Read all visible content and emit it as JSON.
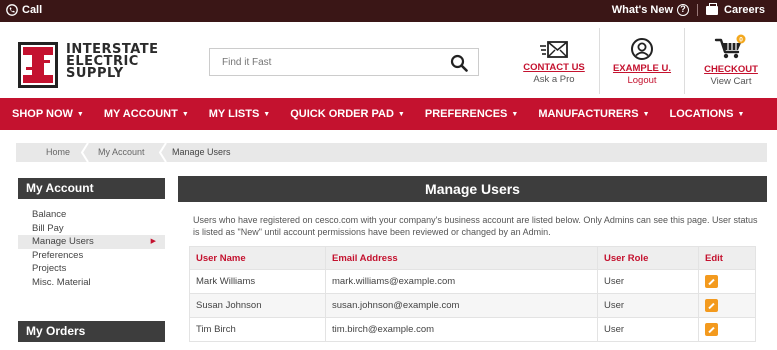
{
  "topbar": {
    "call_label": "Call",
    "whats_new_label": "What's New",
    "careers_label": "Careers"
  },
  "brand": {
    "line1": "INTERSTATE",
    "line2": "ELECTRIC",
    "line3": "SUPPLY"
  },
  "search": {
    "placeholder": "Find it Fast"
  },
  "header": {
    "contact_title": "CONTACT US",
    "contact_sub": "Ask a Pro",
    "user_title": "EXAMPLE U.",
    "user_sub": "Logout",
    "checkout_title": "CHECKOUT",
    "checkout_sub": "View Cart",
    "cart_count": "0"
  },
  "nav": {
    "items": [
      "SHOP NOW",
      "MY ACCOUNT",
      "MY LISTS",
      "QUICK ORDER PAD",
      "PREFERENCES",
      "MANUFACTURERS",
      "LOCATIONS"
    ]
  },
  "breadcrumb": {
    "items": [
      "Home",
      "My Account",
      "Manage Users"
    ]
  },
  "sidebar": {
    "account_heading": "My Account",
    "items": [
      "Balance",
      "Bill Pay",
      "Manage Users",
      "Preferences",
      "Projects",
      "Misc. Material"
    ],
    "orders_heading": "My Orders"
  },
  "main": {
    "title": "Manage Users",
    "description": "Users who have registered on cesco.com with your company's business account are listed below. Only Admins can see this page. User status is listed as \"New\" until account permissions have been reviewed or changed by an Admin.",
    "columns": [
      "User Name",
      "Email Address",
      "User Role",
      "Edit"
    ],
    "rows": [
      {
        "name": "Mark Williams",
        "email": "mark.williams@example.com",
        "role": "User"
      },
      {
        "name": "Susan Johnson",
        "email": "susan.johnson@example.com",
        "role": "User"
      },
      {
        "name": "Tim Birch",
        "email": "tim.birch@example.com",
        "role": "User"
      }
    ]
  },
  "colors": {
    "brand_red": "#c4122f",
    "dark_bar": "#3a1616",
    "panel_head": "#3d3d3d",
    "edit_orange": "#f39a1e"
  }
}
